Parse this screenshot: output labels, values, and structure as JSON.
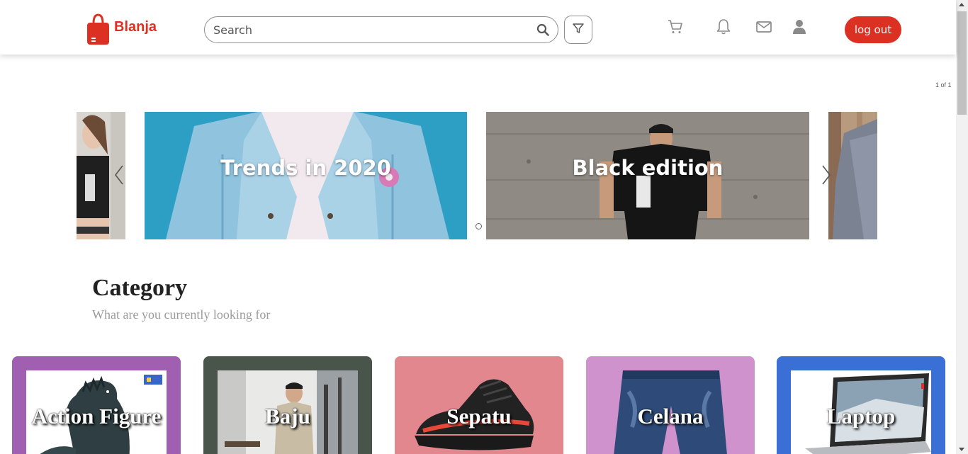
{
  "brand": {
    "name": "Blanja",
    "color": "#db3022"
  },
  "search": {
    "placeholder": "Search"
  },
  "nav": {
    "icons": [
      "cart-icon",
      "bell-icon",
      "mail-icon",
      "user-icon"
    ],
    "logout_label": "log out"
  },
  "carousel": {
    "counter": "1 of 1",
    "slides": [
      {
        "title": ""
      },
      {
        "title": "Trends in 2020"
      },
      {
        "title": "Black edition"
      },
      {
        "title": ""
      }
    ]
  },
  "category": {
    "title": "Category",
    "subtitle": "What are you currently looking for",
    "items": [
      {
        "label": "Action Figure",
        "color": "#a05fb0"
      },
      {
        "label": "Baju",
        "color": "#49544a"
      },
      {
        "label": "Sepatu",
        "color": "#e2878e"
      },
      {
        "label": "Celana",
        "color": "#cf92cc"
      },
      {
        "label": "Laptop",
        "color": "#3a6fd6"
      }
    ]
  }
}
